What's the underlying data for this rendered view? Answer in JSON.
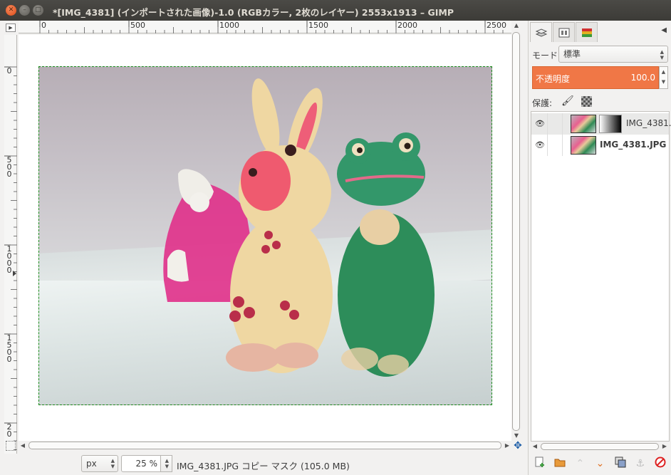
{
  "window": {
    "title": "*[IMG_4381] (インポートされた画像)-1.0 (RGBカラー, 2枚のレイヤー) 2553x1913 – GIMP"
  },
  "rulers": {
    "horizontal_labels": [
      "0",
      "500",
      "1000",
      "1500",
      "2000",
      "2500"
    ],
    "vertical_labels": [
      "0",
      "500",
      "1000",
      "1500",
      "20"
    ]
  },
  "canvas": {
    "image_name": "IMG_4381"
  },
  "statusbar": {
    "unit": "px",
    "zoom": "25 %",
    "message": "IMG_4381.JPG コピー マスク (105.0 MB)"
  },
  "dock": {
    "tabs": [
      {
        "name": "layers-tab",
        "icon": "layers-icon"
      },
      {
        "name": "channels-tab",
        "icon": "channels-icon"
      },
      {
        "name": "paths-tab",
        "icon": "paths-icon"
      }
    ],
    "mode_label": "モード:",
    "mode_value": "標準",
    "opacity_label": "不透明度",
    "opacity_value": "100.0",
    "protect_label": "保護:",
    "layers": [
      {
        "name": "IMG_4381.",
        "visible": true,
        "has_mask": true,
        "selected": true
      },
      {
        "name": "IMG_4381.JPG",
        "visible": true,
        "has_mask": false,
        "selected": false
      }
    ],
    "actions": [
      "new-layer-icon",
      "new-group-icon",
      "raise-layer-icon",
      "lower-layer-icon",
      "duplicate-layer-icon",
      "anchor-layer-icon",
      "delete-layer-icon"
    ]
  },
  "colors": {
    "opacity_bar": "#f07746",
    "selection_border": "#1a8a1a",
    "titlebar": "#3c3b37",
    "close_button": "#df4a16"
  }
}
